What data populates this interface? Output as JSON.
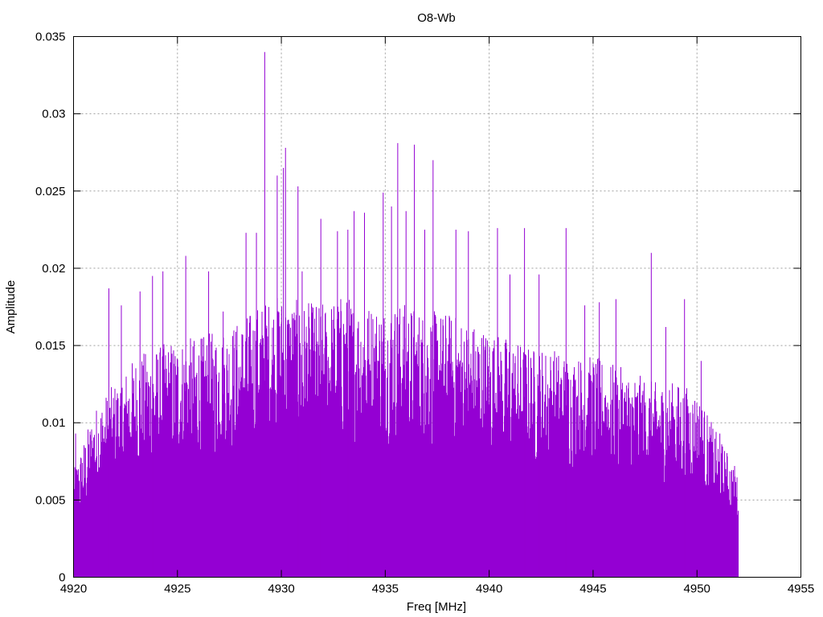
{
  "chart_data": {
    "type": "line",
    "style": "impulses",
    "title": "O8-Wb",
    "xlabel": "Freq [MHz]",
    "ylabel": "Amplitude",
    "xlim": [
      4920,
      4955
    ],
    "ylim": [
      0,
      0.035
    ],
    "xticks": [
      4920,
      4925,
      4930,
      4935,
      4940,
      4945,
      4950,
      4955
    ],
    "xtick_labels": [
      "4920",
      "4925",
      "4930",
      "4935",
      "4940",
      "4945",
      "4950",
      "4955"
    ],
    "yticks": [
      0,
      0.005,
      0.01,
      0.015,
      0.02,
      0.025,
      0.03,
      0.035
    ],
    "ytick_labels": [
      "0",
      "0.005",
      "0.01",
      "0.015",
      "0.02",
      "0.025",
      "0.03",
      "0.035"
    ],
    "grid": true,
    "legend": "none",
    "series_color": "#9400d3",
    "dense_band": {
      "x": [
        4920,
        4921,
        4922,
        4923,
        4924,
        4925,
        4926,
        4927,
        4928,
        4929,
        4930,
        4931,
        4932,
        4933,
        4934,
        4935,
        4936,
        4937,
        4938,
        4939,
        4940,
        4941,
        4942,
        4943,
        4944,
        4945,
        4946,
        4947,
        4948,
        4949,
        4950,
        4951,
        4952
      ],
      "upper": [
        0.006,
        0.0095,
        0.011,
        0.0125,
        0.013,
        0.0135,
        0.0135,
        0.014,
        0.0145,
        0.0155,
        0.016,
        0.0155,
        0.0155,
        0.016,
        0.0155,
        0.0155,
        0.0155,
        0.015,
        0.015,
        0.0145,
        0.014,
        0.0135,
        0.013,
        0.013,
        0.0125,
        0.0125,
        0.012,
        0.0115,
        0.011,
        0.011,
        0.0105,
        0.008,
        0.006
      ]
    },
    "peaks": [
      [
        4920.1,
        0.0093
      ],
      [
        4921.7,
        0.0187
      ],
      [
        4922.3,
        0.0176
      ],
      [
        4923.2,
        0.0185
      ],
      [
        4923.8,
        0.0195
      ],
      [
        4924.3,
        0.0198
      ],
      [
        4925.4,
        0.0208
      ],
      [
        4926.5,
        0.0198
      ],
      [
        4927.2,
        0.0172
      ],
      [
        4928.3,
        0.0223
      ],
      [
        4928.8,
        0.0223
      ],
      [
        4929.2,
        0.034
      ],
      [
        4929.8,
        0.026
      ],
      [
        4930.1,
        0.0265
      ],
      [
        4930.2,
        0.0278
      ],
      [
        4930.8,
        0.0253
      ],
      [
        4931.0,
        0.0198
      ],
      [
        4931.9,
        0.0232
      ],
      [
        4932.7,
        0.0224
      ],
      [
        4933.2,
        0.0225
      ],
      [
        4933.5,
        0.0237
      ],
      [
        4934.0,
        0.0236
      ],
      [
        4934.9,
        0.0249
      ],
      [
        4935.3,
        0.024
      ],
      [
        4935.6,
        0.0281
      ],
      [
        4936.0,
        0.0237
      ],
      [
        4936.4,
        0.028
      ],
      [
        4936.9,
        0.0225
      ],
      [
        4937.3,
        0.027
      ],
      [
        4938.4,
        0.0225
      ],
      [
        4939.0,
        0.0224
      ],
      [
        4940.4,
        0.0226
      ],
      [
        4941.0,
        0.0196
      ],
      [
        4941.7,
        0.0226
      ],
      [
        4942.4,
        0.0196
      ],
      [
        4943.7,
        0.0226
      ],
      [
        4944.6,
        0.0176
      ],
      [
        4945.3,
        0.0178
      ],
      [
        4946.1,
        0.018
      ],
      [
        4947.8,
        0.021
      ],
      [
        4948.5,
        0.0162
      ],
      [
        4949.4,
        0.018
      ],
      [
        4950.2,
        0.014
      ],
      [
        4951.1,
        0.0093
      ],
      [
        4951.9,
        0.0045
      ]
    ]
  }
}
